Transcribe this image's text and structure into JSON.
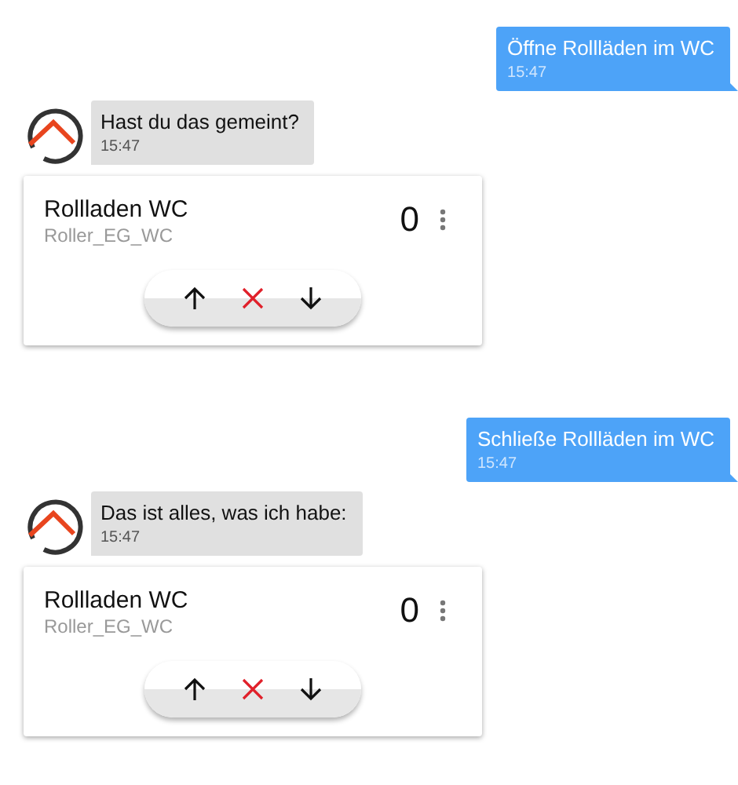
{
  "messages": [
    {
      "kind": "user",
      "text": "Öffne Rollläden im WC",
      "time": "15:47"
    },
    {
      "kind": "bot",
      "text": "Hast du das gemeint?",
      "time": "15:47"
    },
    {
      "kind": "card",
      "title": "Rollladen WC",
      "subtitle": "Roller_EG_WC",
      "value": "0"
    },
    {
      "kind": "user",
      "text": "Schließe Rollläden im WC",
      "time": "15:47"
    },
    {
      "kind": "bot",
      "text": "Das ist alles, was ich habe:",
      "time": "15:47"
    },
    {
      "kind": "card",
      "title": "Rollladen WC",
      "subtitle": "Roller_EG_WC",
      "value": "0"
    }
  ]
}
